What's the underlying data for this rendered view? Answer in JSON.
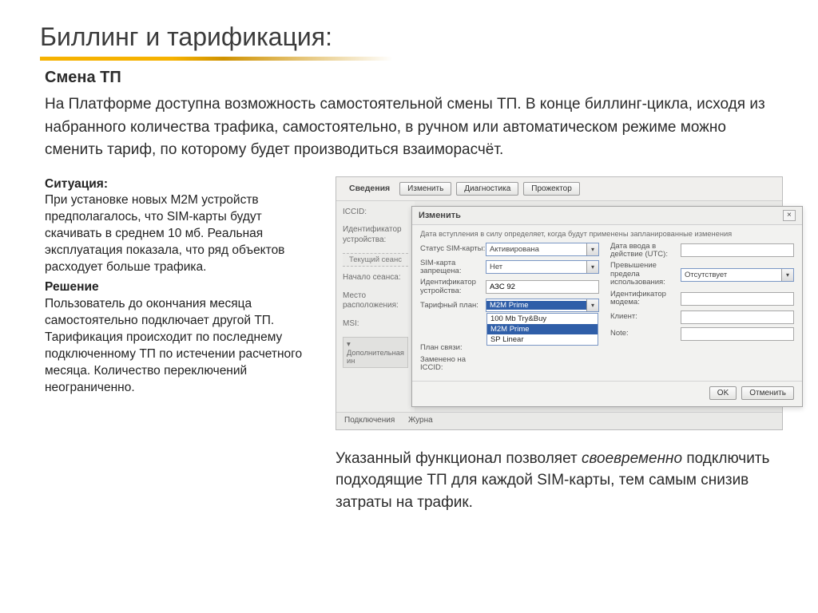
{
  "title": "Биллинг и тарификация:",
  "subtitle": "Смена ТП",
  "intro": "На Платформе доступна возможность самостоятельной смены ТП. В конце биллинг-цикла, исходя из набранного количества трафика, самостоятельно, в ручном или автоматическом режиме можно сменить тариф, по которому будет производиться взаиморасчёт.",
  "situation_label": "Ситуация:",
  "situation_text": "При установке новых М2М устройств предполагалось, что SIM-карты будут скачивать в среднем 10 мб. Реальная эксплуатация показала, что ряд объектов расходует больше трафика.",
  "solution_label": "Решение",
  "solution_text": "Пользователь до окончания месяца самостоятельно подключает другой ТП.\nТарификация происходит по последнему подключенному ТП по истечении расчетного месяца. Количество переключений неограниченно.",
  "summary_pre": "Указанный функционал позволяет ",
  "summary_em": "своевременно",
  "summary_post": " подключить подходящие ТП для каждой SIM-карты, тем самым снизив затраты на трафик.",
  "panel": {
    "main_tab": "Сведения",
    "btn_edit": "Изменить",
    "btn_diag": "Диагностика",
    "btn_proj": "Прожектор",
    "side": {
      "iccid": "ICCID:",
      "devid": "Идентификатор устройства:",
      "session_sec": "Текущий сеанс",
      "sess_start": "Начало сеанса:",
      "location": "Место расположения:",
      "msi": "MSI:",
      "addl": "Дополнительная ин"
    },
    "bottom": {
      "t1": "Подключения",
      "t2": "Журна"
    }
  },
  "modal": {
    "title": "Изменить",
    "note": "Дата вступления в силу определяет, когда будут применены запланированные изменения",
    "left": {
      "status_l": "Статус SIM-карты:",
      "status_v": "Активирована",
      "blocked_l": "SIM-карта запрещена:",
      "blocked_v": "Нет",
      "devid_l": "Идентификатор устройства:",
      "devid_v": "АЗС 92",
      "tariff_l": "Тарифный план:",
      "tariff_v": "M2M Prime",
      "plan_l": "План связи:",
      "repl_l": "Заменено на ICCID:",
      "opts": {
        "o1": "100 Mb Try&Buy",
        "o2": "M2M Prime",
        "o3": "SP Linear"
      }
    },
    "right": {
      "date_l": "Дата ввода в действие (UTC):",
      "over_l": "Превышение предела использования:",
      "over_v": "Отсутствует",
      "modem_l": "Идентификатор модема:",
      "client_l": "Клиент:",
      "note_l": "Note:"
    },
    "ok": "OK",
    "cancel": "Отменить"
  }
}
